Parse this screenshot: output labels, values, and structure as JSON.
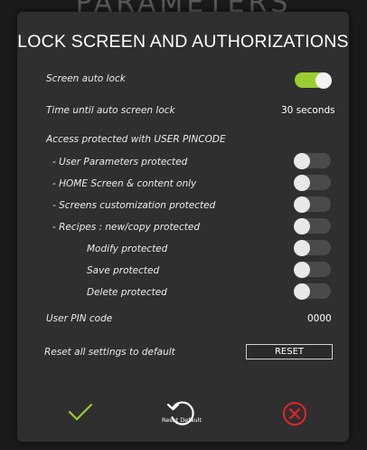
{
  "background_title": "PARAMETERS",
  "panel": {
    "title": "LOCK SCREEN AND AUTHORIZATIONS"
  },
  "rows": {
    "screen_auto_lock": {
      "label": "Screen auto lock",
      "enabled": true
    },
    "time_until_lock": {
      "label": "Time until auto screen lock",
      "value": "30 seconds"
    },
    "access_protected": {
      "label": "Access protected with USER PINCODE"
    },
    "user_parameters": {
      "label": "- User Parameters  protected",
      "enabled": false
    },
    "home_screen": {
      "label": "- HOME Screen & content only",
      "enabled": false
    },
    "screens_customization": {
      "label": "- Screens customization protected",
      "enabled": false
    },
    "recipes": {
      "label": "- Recipes : new/copy protected",
      "enabled": false
    },
    "modify": {
      "label": "Modify protected",
      "enabled": false
    },
    "save": {
      "label": "Save protected",
      "enabled": false
    },
    "delete": {
      "label": "Delete protected",
      "enabled": false
    },
    "user_pin": {
      "label": "User PIN code",
      "value": "0000"
    },
    "reset_all": {
      "label": "Reset all settings to default",
      "button_label": "RESET"
    }
  },
  "footer": {
    "confirm_icon": "checkmark-icon",
    "reset_default_icon": "reset-arrow-icon",
    "reset_default_label": "Reset Default",
    "cancel_icon": "cancel-circle-icon"
  },
  "colors": {
    "accent_green": "#9acd32",
    "cancel_red": "#e0242b",
    "panel_bg": "#2f2f2f",
    "page_bg": "#1b1b1b"
  }
}
